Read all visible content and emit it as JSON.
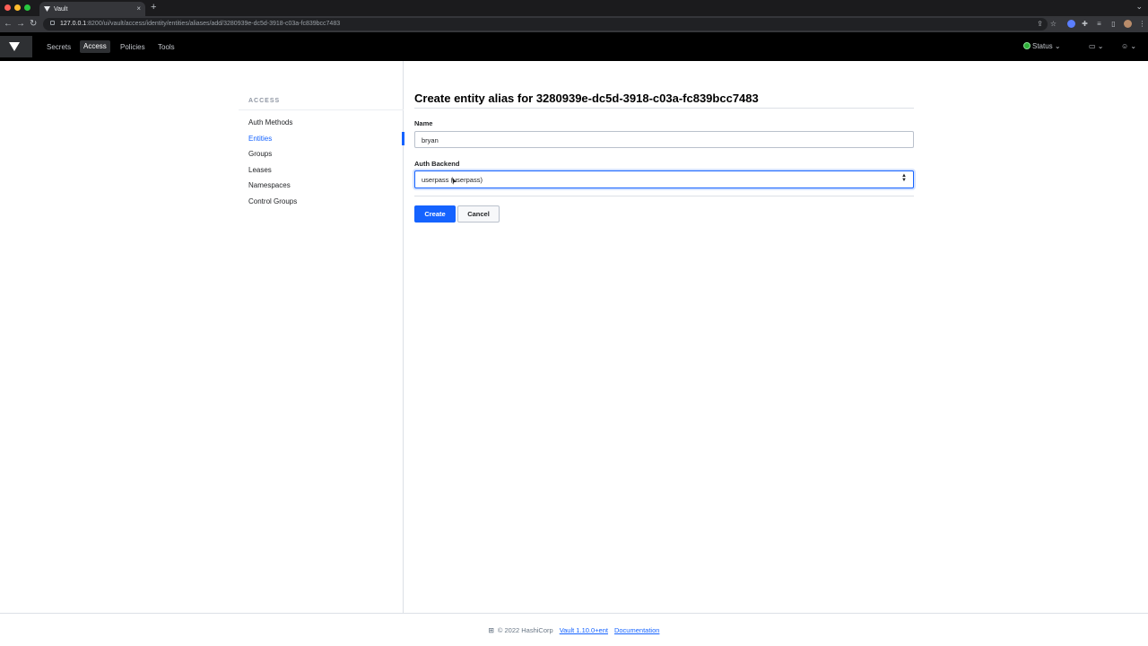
{
  "browser": {
    "tab_title": "Vault",
    "tab_close": "×",
    "new_tab": "+",
    "url_host": "127.0.0.1",
    "url_rest": ":8200/ui/vault/access/identity/entities/aliases/add/3280939e-dc5d-3918-c03a-fc839bcc7483"
  },
  "nav": {
    "items": [
      "Secrets",
      "Access",
      "Policies",
      "Tools"
    ],
    "active": "Access",
    "status_label": "Status",
    "status_color": "#2eb039"
  },
  "sidebar": {
    "heading": "ACCESS",
    "items": [
      "Auth Methods",
      "Entities",
      "Groups",
      "Leases",
      "Namespaces",
      "Control Groups"
    ],
    "active": "Entities"
  },
  "form": {
    "title": "Create entity alias for 3280939e-dc5d-3918-c03a-fc839bcc7483",
    "name_label": "Name",
    "name_value": "bryan",
    "backend_label": "Auth Backend",
    "backend_value": "userpass (userpass)",
    "create_label": "Create",
    "cancel_label": "Cancel"
  },
  "footer": {
    "copyright": "© 2022 HashiCorp",
    "version": "Vault 1.10.0+ent",
    "docs": "Documentation"
  },
  "colors": {
    "accent": "#1563ff",
    "nav_bg": "#000000"
  }
}
